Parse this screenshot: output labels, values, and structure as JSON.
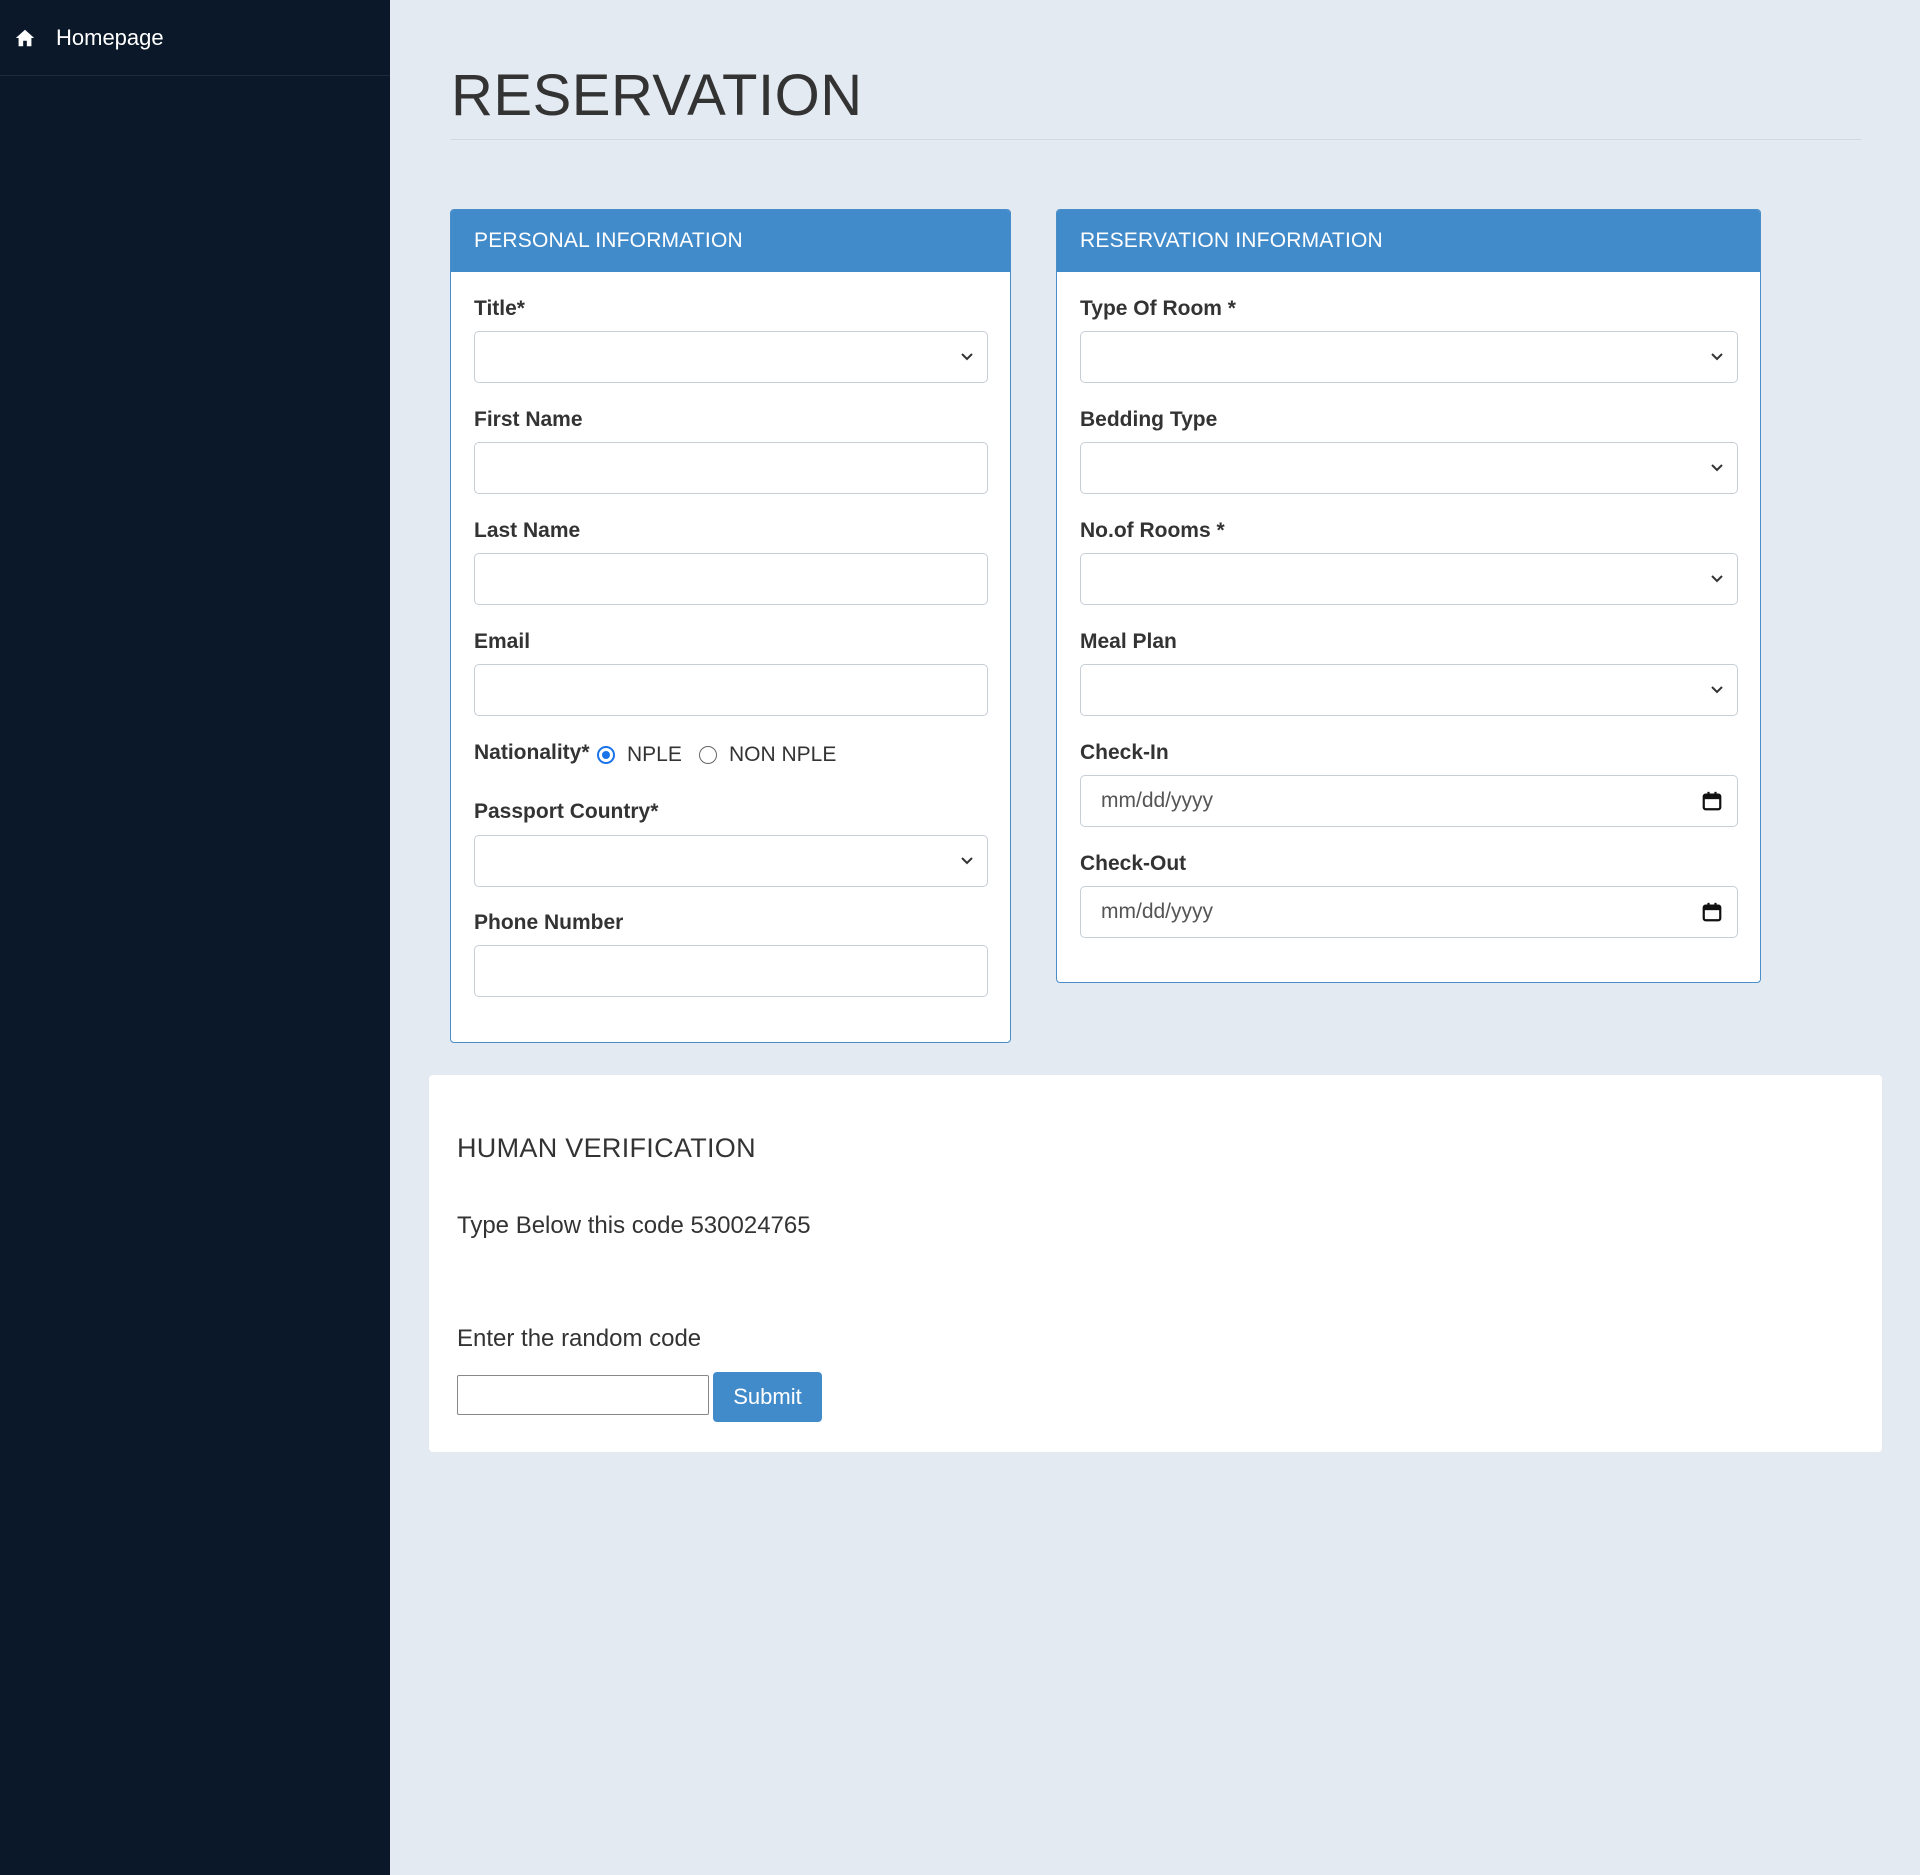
{
  "sidebar": {
    "items": [
      {
        "label": "Homepage",
        "icon": "home-icon"
      }
    ]
  },
  "page": {
    "title": "RESERVATION"
  },
  "personal": {
    "heading": "PERSONAL INFORMATION",
    "title_label": "Title*",
    "title_value": "",
    "first_name_label": "First Name",
    "first_name_value": "",
    "last_name_label": "Last Name",
    "last_name_value": "",
    "email_label": "Email",
    "email_value": "",
    "nationality_label": "Nationality*",
    "nationality_options": [
      "NPLE",
      "NON NPLE"
    ],
    "nationality_selected": "NPLE",
    "passport_label": "Passport Country*",
    "passport_value": "",
    "phone_label": "Phone Number",
    "phone_value": ""
  },
  "reservation": {
    "heading": "RESERVATION INFORMATION",
    "room_type_label": "Type Of Room *",
    "bedding_label": "Bedding Type",
    "rooms_label": "No.of Rooms *",
    "meal_label": "Meal Plan",
    "checkin_label": "Check-In",
    "checkin_placeholder": "mm/dd/yyyy",
    "checkout_label": "Check-Out",
    "checkout_placeholder": "mm/dd/yyyy"
  },
  "verification": {
    "title": "HUMAN VERIFICATION",
    "code_text": "Type Below this code 530024765",
    "input_label": "Enter the random code",
    "input_value": "",
    "submit_label": "Submit"
  },
  "colors": {
    "sidebar_bg": "#0b1829",
    "page_bg": "#e4eaf2",
    "panel_heading": "#428bca",
    "radio_accent": "#1a73e8"
  }
}
